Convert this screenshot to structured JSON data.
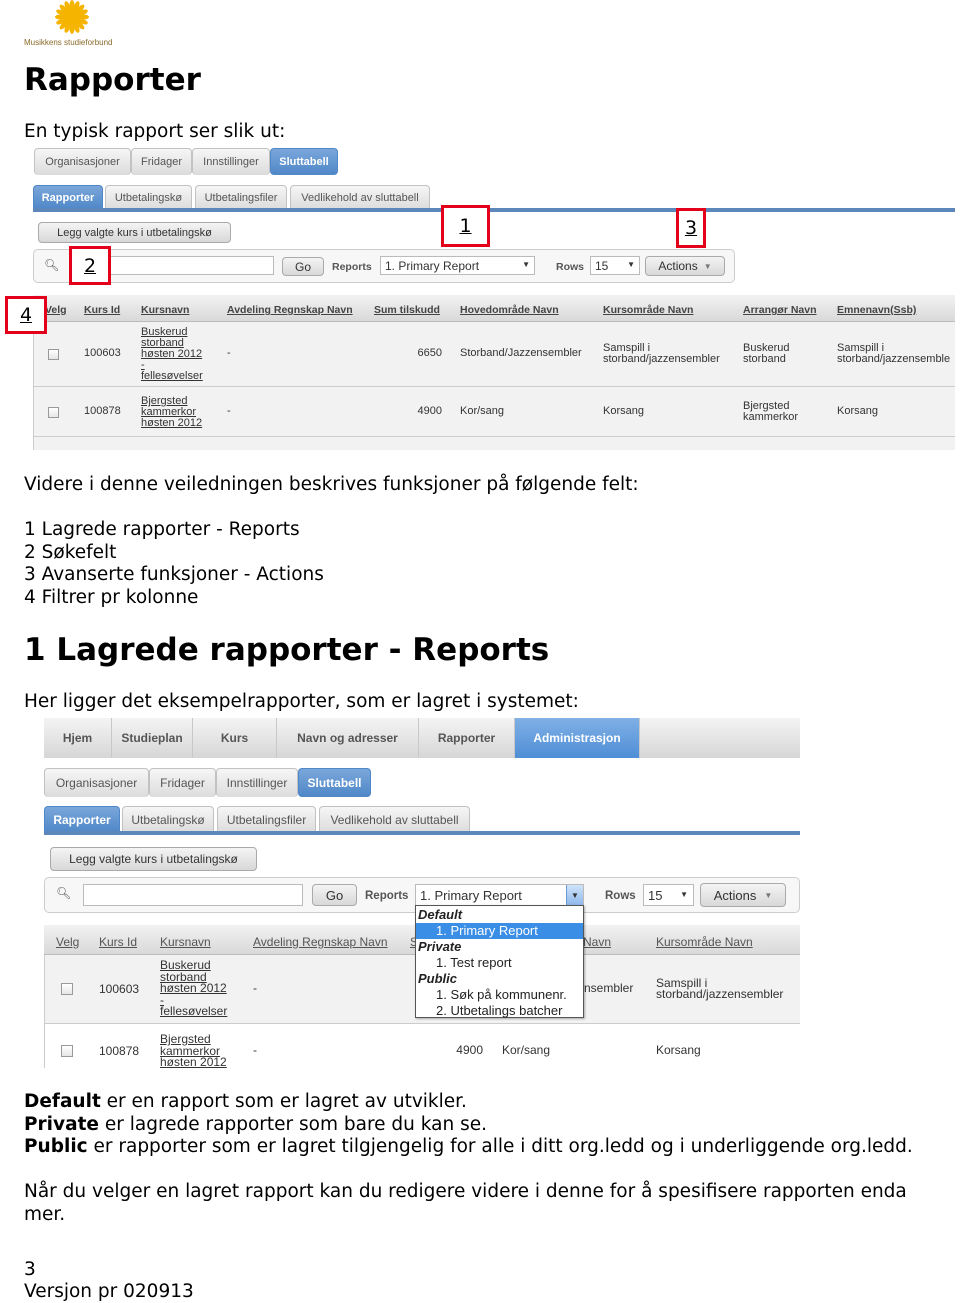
{
  "logo": {
    "text": "Musikkens studieforbund",
    "color": "#f5b400"
  },
  "title": "Rapporter",
  "intro": "En typisk rapport ser slik ut:",
  "screenshot1": {
    "tabs_top": [
      "Organisasjoner",
      "Fridager",
      "Innstillinger",
      "Sluttabell"
    ],
    "tabs_sub": [
      "Rapporter",
      "Utbetalingskø",
      "Utbetalingsfiler",
      "Vedlikehold av sluttabell"
    ],
    "add_button": "Legg valgte kurs i utbetalingskø",
    "go": "Go",
    "reports_label": "Reports",
    "report_selected": "1. Primary Report",
    "rows_label": "Rows",
    "rows_value": "15",
    "actions": "Actions",
    "markers": [
      "1",
      "2",
      "3",
      "4"
    ],
    "columns": [
      "Velg",
      "Kurs Id",
      "Kursnavn",
      "Avdeling Regnskap Navn",
      "Sum tilskudd",
      "Hovedområde Navn",
      "Kursområde Navn",
      "Arrangør Navn",
      "Emnenavn(Ssb)"
    ],
    "rows": [
      {
        "id": "100603",
        "kursnavn": "Buskerud\nstorband\nhøsten 2012\n-\nfellesøvelser",
        "avdeling": "-",
        "sum": "6650",
        "hoved": "Storband/Jazzensembler",
        "kursomrade": "Samspill i\nstorband/jazzensembler",
        "arrangor": "Buskerud\nstorband",
        "emne": "Samspill i\nstorband/jazzensemble"
      },
      {
        "id": "100878",
        "kursnavn": "Bjergsted\nkammerkor\nhøsten 2012",
        "avdeling": "-",
        "sum": "4900",
        "hoved": "Kor/sang",
        "kursomrade": "Korsang",
        "arrangor": "Bjergsted\nkammerkor",
        "emne": "Korsang"
      }
    ]
  },
  "fields_intro": "Videre i denne veiledningen beskrives funksjoner på følgende felt:",
  "fields": [
    "1 Lagrede rapporter - Reports",
    "2 Søkefelt",
    "3 Avanserte funksjoner - Actions",
    "4 Filtrer pr kolonne"
  ],
  "section1_title": "1 Lagrede rapporter - Reports",
  "section1_intro": "Her ligger det eksempelrapporter, som er lagret i systemet:",
  "screenshot2": {
    "nav": [
      "Hjem",
      "Studieplan",
      "Kurs",
      "Navn og adresser",
      "Rapporter",
      "Administrasjon"
    ],
    "tabs_top": [
      "Organisasjoner",
      "Fridager",
      "Innstillinger",
      "Sluttabell"
    ],
    "tabs_sub": [
      "Rapporter",
      "Utbetalingskø",
      "Utbetalingsfiler",
      "Vedlikehold av sluttabell"
    ],
    "add_button": "Legg valgte kurs i utbetalingskø",
    "go": "Go",
    "reports_label": "Reports",
    "report_selected": "1. Primary Report",
    "rows_label": "Rows",
    "rows_value": "15",
    "actions": "Actions",
    "dropdown": [
      {
        "group": "Default",
        "items": [
          "1. Primary Report"
        ]
      },
      {
        "group": "Private",
        "items": [
          "1. Test report"
        ]
      },
      {
        "group": "Public",
        "items": [
          "1. Søk på kommunenr.",
          "2. Utbetalings batcher"
        ]
      }
    ],
    "columns": [
      "Velg",
      "Kurs Id",
      "Kursnavn",
      "Avdeling Regnskap Navn",
      "S",
      "Navn",
      "Kursområde Navn"
    ],
    "rows": [
      {
        "id": "100603",
        "kursnavn": "Buskerud\nstorband\nhøsten 2012\n-\nfellesøvelser",
        "avdeling": "-",
        "sum": "",
        "hoved": "nsembler",
        "kursomrade": "Samspill i\nstorband/jazzensembler"
      },
      {
        "id": "100878",
        "kursnavn": "Bjergsted\nkammerkor\nhøsten 2012",
        "avdeling": "-",
        "sum": "4900",
        "hoved": "Kor/sang",
        "kursomrade": "Korsang"
      }
    ]
  },
  "definitions": [
    {
      "term": "Default",
      "text": " er en rapport som er lagret av utvikler."
    },
    {
      "term": "Private",
      "text": " er lagrede rapporter som bare du kan se."
    },
    {
      "term": "Public",
      "text": " er rapporter som er lagret tilgjengelig for alle i ditt org.ledd og i underliggende org.ledd."
    }
  ],
  "closing_line1": "Når du velger en lagret rapport kan du redigere videre i denne for å spesifisere rapporten enda",
  "closing_line2": "mer.",
  "footer": {
    "page": "3",
    "version": "Versjon pr 020913"
  },
  "colors": {
    "accent_blue": "#4f87c8",
    "marker_red": "#e3001b"
  }
}
